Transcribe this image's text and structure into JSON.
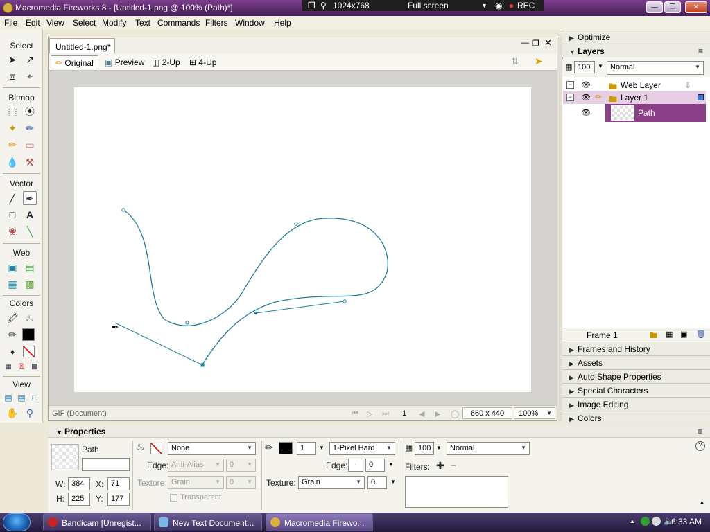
{
  "window": {
    "title": "Macromedia Fireworks 8 - [Untitled-1.png @ 100% (Path)*]"
  },
  "recorder": {
    "resolution": "1024x768",
    "mode": "Full screen",
    "rec": "REC"
  },
  "menu": [
    "File",
    "Edit",
    "View",
    "Select",
    "Modify",
    "Text",
    "Commands",
    "Filters",
    "Window",
    "Help"
  ],
  "tools": {
    "sections": [
      "Select",
      "Bitmap",
      "Vector",
      "Web",
      "Colors",
      "View"
    ]
  },
  "document": {
    "tab": "Untitled-1.png*",
    "views": [
      "Original",
      "Preview",
      "2-Up",
      "4-Up"
    ],
    "status_format": "GIF (Document)",
    "frame": "1",
    "size": "660 x 440",
    "zoom": "100%"
  },
  "panels": {
    "optimize": "Optimize",
    "layers": {
      "title": "Layers",
      "opacity": "100",
      "blend": "Normal",
      "rows": [
        {
          "name": "Web Layer"
        },
        {
          "name": "Layer 1"
        },
        {
          "name": "Path"
        }
      ],
      "frame": "Frame 1"
    },
    "collapsed": [
      "Frames and History",
      "Assets",
      "Auto Shape Properties",
      "Special Characters",
      "Image Editing",
      "Colors"
    ]
  },
  "properties": {
    "title": "Properties",
    "object": "Path",
    "w_label": "W:",
    "w": "384",
    "x_label": "X:",
    "x": "71",
    "h_label": "H:",
    "h": "225",
    "y_label": "Y:",
    "y": "177",
    "fill": "None",
    "edge_label": "Edge:",
    "fill_edge": "Anti-Alias",
    "fill_edge_amt": "0",
    "texture_label": "Texture:",
    "fill_texture": "Grain",
    "fill_texture_amt": "0",
    "transparent": "Transparent",
    "stroke_size": "1",
    "stroke_type": "1-Pixel Hard",
    "stroke_edge_amt": "0",
    "stroke_texture": "Grain",
    "stroke_texture_amt": "0",
    "opacity": "100",
    "blend": "Normal",
    "filters_label": "Filters:"
  },
  "taskbar": {
    "tasks": [
      "Bandicam [Unregist...",
      "New Text Document...",
      "Macromedia Firewo..."
    ],
    "time": "6:33 AM"
  },
  "colors": {
    "path": "#1f7f9a",
    "layer_selected": "#8a3f86",
    "title": "#5a2a6a"
  }
}
